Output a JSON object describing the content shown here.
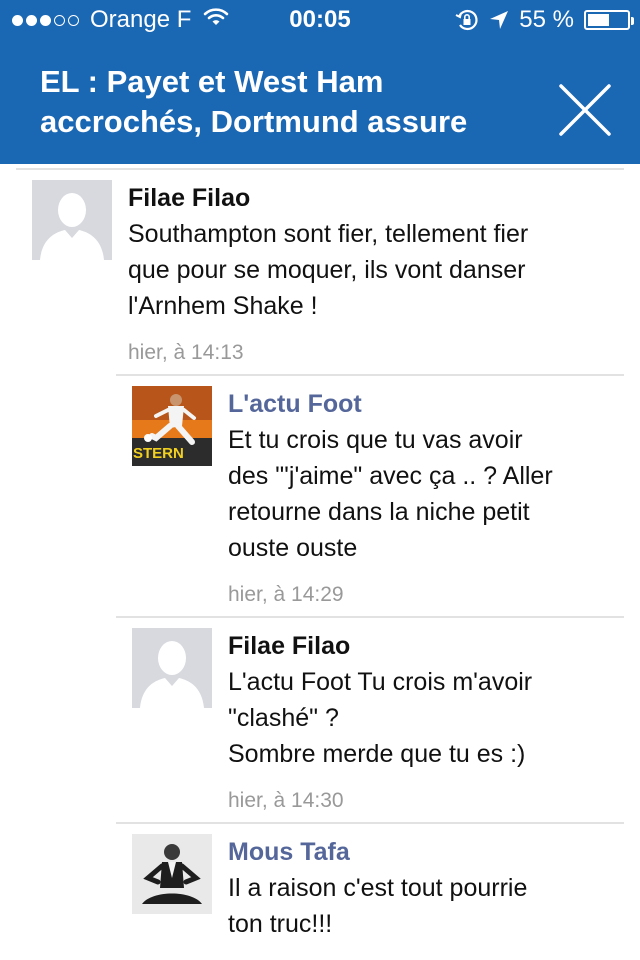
{
  "status_bar": {
    "carrier": "Orange F",
    "time": "00:05",
    "battery_percent": "55 %",
    "battery_level": 0.55,
    "signal_bars_filled": 3,
    "signal_bars_total": 5,
    "icons": [
      "wifi-icon",
      "orientation-lock-icon",
      "location-arrow-icon",
      "battery-icon"
    ]
  },
  "header": {
    "title": "EL : Payet et West Ham accrochés, Dortmund assure",
    "close_icon": "close-icon",
    "background_color": "#1a67b4"
  },
  "comments": [
    {
      "author": "Filae Filao",
      "author_is_link": false,
      "avatar": "default-avatar",
      "text": "Southampton sont fier, tellement fier\nque pour se moquer, ils vont danser\nl'Arnhem Shake !",
      "time": "hier, à 14:13"
    },
    {
      "author": "L'actu Foot",
      "author_is_link": true,
      "avatar": "football-photo-avatar",
      "text": "Et tu crois que tu vas avoir\ndes \"'j'aime\" avec ça .. ? Aller\nretourne dans la niche petit\nouste ouste",
      "time": "hier, à 14:29"
    },
    {
      "author": "Filae Filao",
      "author_is_link": false,
      "avatar": "default-avatar",
      "text": "L'actu Foot Tu crois m'avoir\n\"clashé\" ?\nSombre merde que tu es :)",
      "time": "hier, à 14:30"
    },
    {
      "author": "Mous Tafa",
      "author_is_link": true,
      "avatar": "meditating-man-photo-avatar",
      "text": "Il a raison c'est tout pourrie\nton truc!!!",
      "time": ""
    }
  ]
}
